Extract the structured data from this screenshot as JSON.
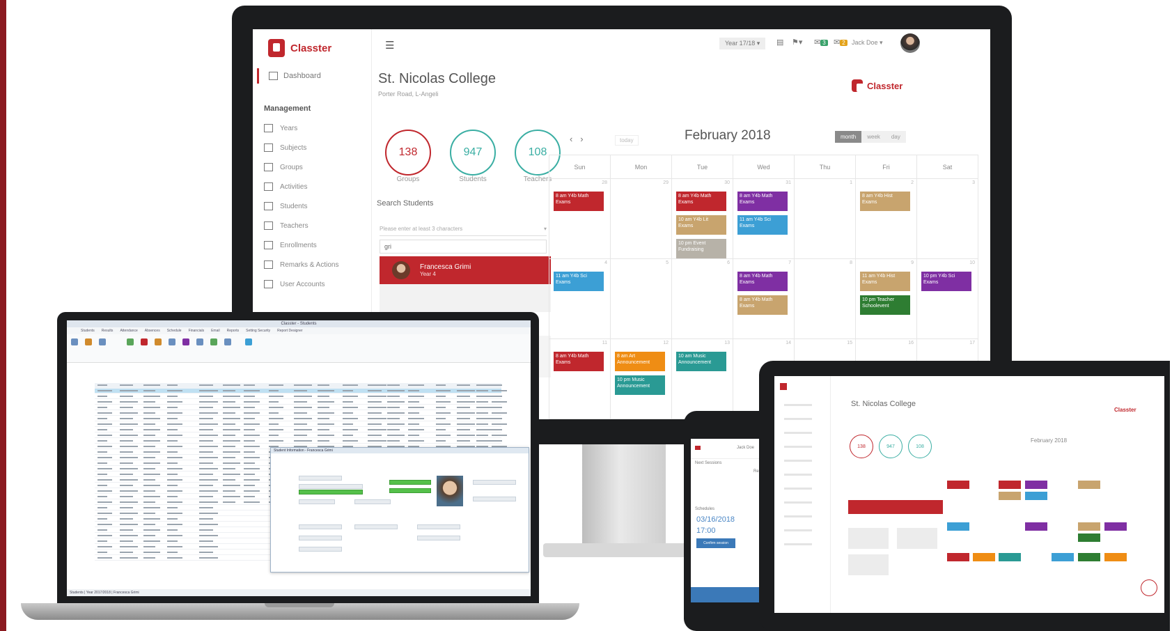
{
  "monitor": {
    "app_name": "Classter",
    "sidebar": {
      "dashboard": "Dashboard",
      "section": "Management",
      "items": [
        "Years",
        "Subjects",
        "Groups",
        "Activities",
        "Students",
        "Teachers",
        "Enrollments",
        "Remarks & Actions",
        "User Accounts"
      ]
    },
    "topbar": {
      "year": "Year 17/18 ▾",
      "username": "Jack Doe ▾",
      "badge1": "3",
      "badge2": "2"
    },
    "college": {
      "name": "St. Nicolas College",
      "address": "Porter Road, L-Angeli",
      "brand": "Classter"
    },
    "stats": [
      {
        "value": "138",
        "label": "Groups"
      },
      {
        "value": "947",
        "label": "Students"
      },
      {
        "value": "108",
        "label": "Teachers"
      }
    ],
    "search": {
      "label": "Search Students",
      "placeholder": "Please enter at least 3 characters",
      "query": "gri",
      "result_name": "Francesca Grimi",
      "result_sub": "Year 4"
    },
    "calendar": {
      "title": "February 2018",
      "today": "today",
      "views": [
        "month",
        "week",
        "day"
      ],
      "days": [
        "Sun",
        "Mon",
        "Tue",
        "Wed",
        "Thu",
        "Fri",
        "Sat"
      ],
      "week1_dates": [
        "28",
        "29",
        "30",
        "31",
        "1",
        "2",
        "3"
      ],
      "week2_dates": [
        "4",
        "5",
        "6",
        "7",
        "8",
        "9",
        "10"
      ],
      "week3_dates": [
        "11",
        "12",
        "13",
        "14",
        "15",
        "16",
        "17"
      ],
      "events": [
        {
          "row": 0,
          "col": 0,
          "slot": 0,
          "color": "red",
          "text": "8 am Y4b Math Exams"
        },
        {
          "row": 0,
          "col": 2,
          "slot": 0,
          "color": "red",
          "text": "8 am Y4b Math Exams"
        },
        {
          "row": 0,
          "col": 2,
          "slot": 1,
          "color": "tan",
          "text": "10 am Y4b Lit Exams"
        },
        {
          "row": 0,
          "col": 2,
          "slot": 2,
          "color": "grey",
          "text": "10 pm Event Fundraising"
        },
        {
          "row": 0,
          "col": 3,
          "slot": 0,
          "color": "purple",
          "text": "8 am Y4b Math Exams"
        },
        {
          "row": 0,
          "col": 3,
          "slot": 1,
          "color": "blue",
          "text": "11 am Y4b Sci Exams"
        },
        {
          "row": 0,
          "col": 5,
          "slot": 0,
          "color": "tan",
          "text": "8 am Y4b Hist Exams"
        },
        {
          "row": 1,
          "col": 0,
          "slot": 0,
          "color": "blue",
          "text": "11 am Y4b Sci Exams"
        },
        {
          "row": 1,
          "col": 3,
          "slot": 0,
          "color": "purple",
          "text": "8 am Y4b Math Exams"
        },
        {
          "row": 1,
          "col": 3,
          "slot": 1,
          "color": "tan",
          "text": "8 am Y4b Math Exams"
        },
        {
          "row": 1,
          "col": 5,
          "slot": 0,
          "color": "tan",
          "text": "11 am Y4b Hist Exams"
        },
        {
          "row": 1,
          "col": 5,
          "slot": 1,
          "color": "green",
          "text": "10 pm Teacher Schoolevent"
        },
        {
          "row": 1,
          "col": 6,
          "slot": 0,
          "color": "purple",
          "text": "10 pm Y4b Sci Exams"
        },
        {
          "row": 2,
          "col": 0,
          "slot": 0,
          "color": "red",
          "text": "8 am Y4b Math Exams"
        },
        {
          "row": 2,
          "col": 1,
          "slot": 0,
          "color": "orange",
          "text": "8 am Art Announcement"
        },
        {
          "row": 2,
          "col": 1,
          "slot": 1,
          "color": "teal",
          "text": "10 pm Music Announcement"
        },
        {
          "row": 2,
          "col": 2,
          "slot": 0,
          "color": "teal",
          "text": "10 am Music Announcement"
        }
      ]
    }
  },
  "laptop": {
    "window_title": "Classter - Students",
    "tabs": [
      "Students",
      "Results",
      "Attendance",
      "Absences",
      "Schedule",
      "Financials",
      "Email",
      "Reports",
      "Setting Security",
      "Report Designer"
    ],
    "dialog_title": "Student Information - Francesca Grimi",
    "statusbar": "Students  |  Year 2017/2018  |  Francesca Grimi"
  },
  "phone": {
    "header": "Jack Doe",
    "menu": [
      "Next Sessions",
      "Remarks",
      "Schedules"
    ],
    "date": "03/16/2018",
    "time": "17:00",
    "button": "Confirm session"
  },
  "tablet": {
    "title": "St. Nicolas College",
    "brand": "Classter",
    "stats": [
      "138",
      "947",
      "108"
    ],
    "calendar_title": "February 2018"
  }
}
